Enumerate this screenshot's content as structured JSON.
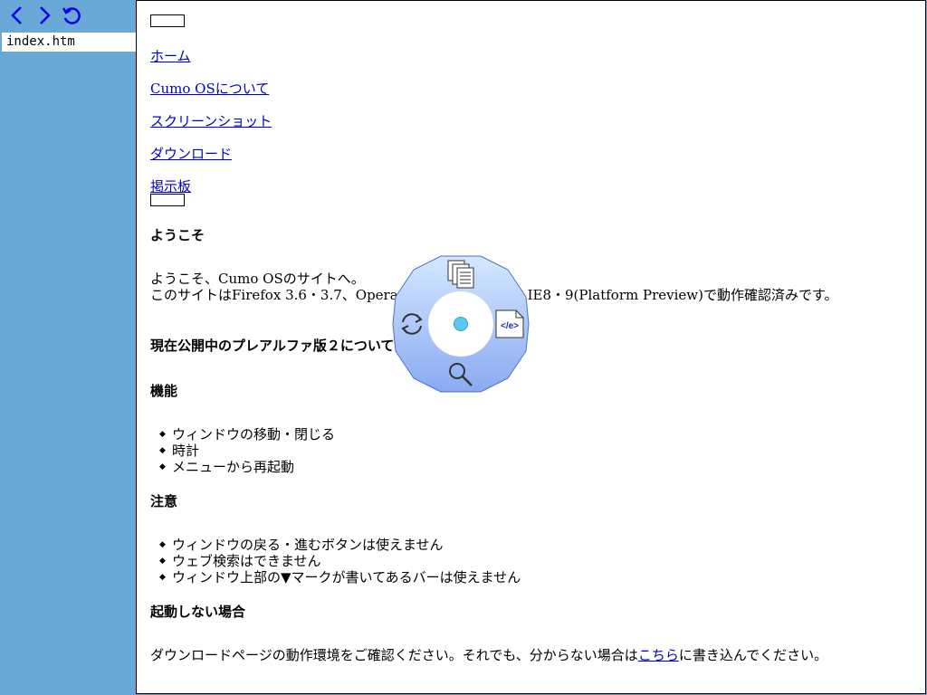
{
  "sidebar": {
    "tab_label": "index.htm"
  },
  "nav": {
    "links": [
      "ホーム",
      "Cumo OSについて",
      "スクリーンショット",
      "ダウンロード",
      "掲示板"
    ]
  },
  "main": {
    "welcome_heading": "ようこそ",
    "welcome_line1": "ようこそ、Cumo OSのサイトへ。",
    "welcome_line2": "このサイトはFirefox 3.6・3.7、Opera 10.5、Chrome 5、IE8・9(Platform Preview)で動作確認済みです。",
    "alpha_heading": "現在公開中のプレアルファ版２について",
    "features_heading": "機能",
    "features": [
      "ウィンドウの移動・閉じる",
      "時計",
      "メニューから再起動"
    ],
    "notes_heading": "注意",
    "notes": [
      "ウィンドウの戻る・進むボタンは使えません",
      "ウェブ検索はできません",
      "ウィンドウ上部の▼マークが書いてあるバーは使えません"
    ],
    "boot_heading": "起動しない場合",
    "boot_text_before": "ダウンロードページの動作環境をご確認ください。それでも、分からない場合は",
    "boot_link": "こちら",
    "boot_text_after": "に書き込んでください。"
  },
  "radial_menu": {
    "source_icon_label": "</e>"
  },
  "colors": {
    "sidebar_bg": "#6aa8d8",
    "link": "#0000cc",
    "radial_fill": "#9ab8f8"
  }
}
